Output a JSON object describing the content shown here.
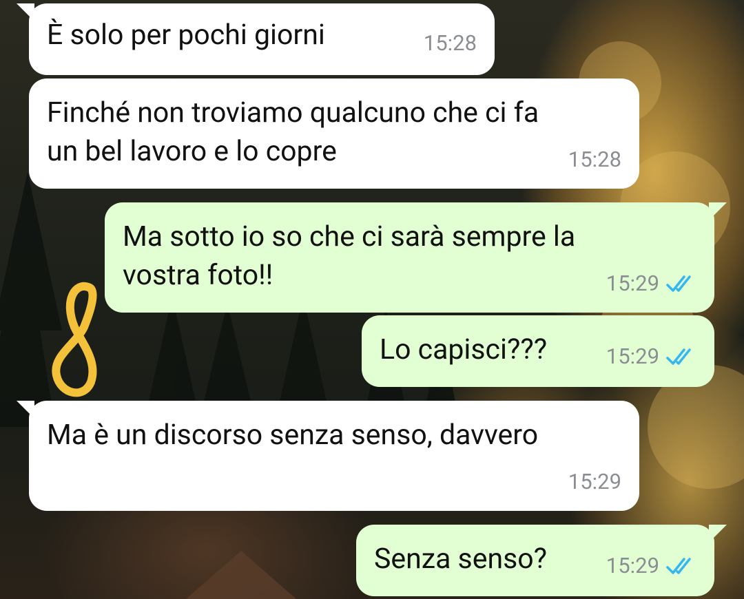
{
  "messages": [
    {
      "dir": "in",
      "text": "È solo per pochi giorni",
      "time": "15:28"
    },
    {
      "dir": "in",
      "text": "Finché non troviamo qualcuno che ci fa\nun bel lavoro e lo copre",
      "time": "15:28"
    },
    {
      "dir": "out",
      "text": "Ma sotto io so che ci sarà sempre la\nvostra foto!!",
      "time": "15:29",
      "status": "read"
    },
    {
      "dir": "out",
      "text": "Lo capisci???",
      "time": "15:29",
      "status": "read"
    },
    {
      "dir": "in",
      "text": "Ma è un discorso senza senso, davvero",
      "time": "15:29"
    },
    {
      "dir": "out",
      "text": "Senza senso?",
      "time": "15:29",
      "status": "read"
    }
  ],
  "colors": {
    "incoming_bubble": "#ffffff",
    "outgoing_bubble": "#e2ffd4",
    "read_ticks": "#34b7f1",
    "timestamp": "#8a8d91",
    "doodle": "#f3c23a"
  },
  "icons": {
    "read_receipt": "double-check-icon",
    "doodle": "hand-drawn-loop"
  }
}
